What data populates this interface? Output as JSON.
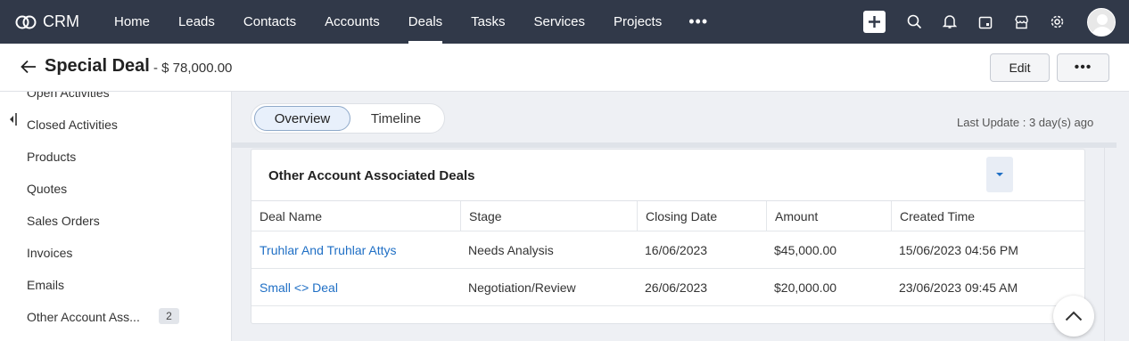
{
  "app": {
    "name": "CRM"
  },
  "nav": {
    "items": [
      {
        "label": "Home",
        "active": false
      },
      {
        "label": "Leads",
        "active": false
      },
      {
        "label": "Contacts",
        "active": false
      },
      {
        "label": "Accounts",
        "active": false
      },
      {
        "label": "Deals",
        "active": true
      },
      {
        "label": "Tasks",
        "active": false
      },
      {
        "label": "Services",
        "active": false
      },
      {
        "label": "Projects",
        "active": false
      }
    ],
    "more": "•••",
    "icons": [
      "add-icon",
      "search-icon",
      "bell-icon",
      "calendar-icon",
      "marketplace-icon",
      "gear-icon",
      "avatar"
    ]
  },
  "header": {
    "title": "Special Deal",
    "subtitle": "- $ 78,000.00",
    "edit_label": "Edit",
    "more_label": "•••"
  },
  "sidebar": {
    "items": [
      {
        "label": "Open Activities"
      },
      {
        "label": "Closed Activities"
      },
      {
        "label": "Products"
      },
      {
        "label": "Quotes"
      },
      {
        "label": "Sales Orders"
      },
      {
        "label": "Invoices"
      },
      {
        "label": "Emails"
      },
      {
        "label": "Other Account Ass...",
        "badge": "2"
      }
    ]
  },
  "tabs": [
    {
      "label": "Overview",
      "selected": true
    },
    {
      "label": "Timeline",
      "selected": false
    }
  ],
  "last_update": "Last Update : 3 day(s) ago",
  "related": {
    "title": "Other Account Associated Deals",
    "columns": [
      "Deal Name",
      "Stage",
      "Closing Date",
      "Amount",
      "Created Time"
    ],
    "rows": [
      [
        "Truhlar And Truhlar Attys",
        "Needs Analysis",
        "16/06/2023",
        "$45,000.00",
        "15/06/2023 04:56 PM"
      ],
      [
        "Small <> Deal",
        "Negotiation/Review",
        "26/06/2023",
        "$20,000.00",
        "23/06/2023 09:45 AM"
      ]
    ]
  },
  "colors": {
    "topbar": "#313949",
    "link": "#1f6fc5",
    "accent_tab": "#e8f0fb"
  }
}
